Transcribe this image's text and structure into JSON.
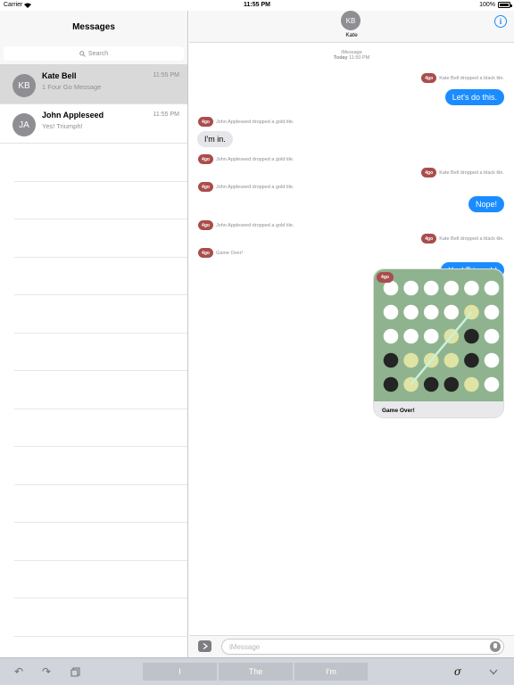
{
  "status_bar": {
    "carrier": "Carrier",
    "time": "11:55 PM",
    "battery": "100%"
  },
  "sidebar": {
    "title": "Messages",
    "search_placeholder": "Search",
    "conversations": [
      {
        "initials": "KB",
        "name": "Kate Bell",
        "time": "11:55 PM",
        "preview": "1 Four Go Message"
      },
      {
        "initials": "JA",
        "name": "John Appleseed",
        "time": "11:55 PM",
        "preview": "Yes! Triumph!"
      }
    ]
  },
  "chat": {
    "contact_initials": "KB",
    "contact_name": "Kate",
    "service": "iMessage",
    "timestamp_day": "Today",
    "timestamp_time": "11:50 PM",
    "badge_label": "4go",
    "events": [
      {
        "kind": "sys",
        "side": "right",
        "text": "Kate Bell dropped a black tile."
      },
      {
        "kind": "bubble",
        "side": "right",
        "text": "Let's do this."
      },
      {
        "kind": "sys",
        "side": "left",
        "text": "John Appleseed dropped a gold tile."
      },
      {
        "kind": "bubble",
        "side": "left",
        "text": "I'm in."
      },
      {
        "kind": "sys",
        "side": "left",
        "text": "John Appleseed dropped a gold tile."
      },
      {
        "kind": "sys",
        "side": "right",
        "text": "Kate Bell dropped a black tile."
      },
      {
        "kind": "sys",
        "side": "left",
        "text": "John Appleseed dropped a gold tile."
      },
      {
        "kind": "bubble",
        "side": "right",
        "text": "Nope!"
      },
      {
        "kind": "sys",
        "side": "left",
        "text": "John Appleseed dropped a gold tile."
      },
      {
        "kind": "sys",
        "side": "right",
        "text": "Kate Bell dropped a black tile."
      },
      {
        "kind": "sys",
        "side": "left",
        "text": "Game Over!"
      },
      {
        "kind": "bubble",
        "side": "right",
        "text": "Yes! Triumph!"
      }
    ],
    "game_card": {
      "caption": "Game Over!",
      "board": [
        [
          "empty",
          "empty",
          "empty",
          "empty",
          "empty",
          "empty"
        ],
        [
          "empty",
          "empty",
          "empty",
          "empty",
          "gold",
          "empty"
        ],
        [
          "empty",
          "empty",
          "empty",
          "gold",
          "black",
          "empty"
        ],
        [
          "black",
          "gold",
          "gold",
          "gold",
          "black",
          "empty"
        ],
        [
          "black",
          "gold",
          "black",
          "black",
          "gold",
          "empty"
        ]
      ],
      "colors": {
        "board": "#8fb38f",
        "empty": "#ffffff",
        "gold": "#dfe3a3",
        "black": "#242424",
        "win_line": "#c9f2dc"
      }
    },
    "input_placeholder": "iMessage"
  },
  "keyboard_bar": {
    "suggestions": [
      "I",
      "The",
      "I'm"
    ],
    "icons": [
      "undo-icon",
      "redo-icon",
      "paste-icon",
      "handwriting-icon",
      "dismiss-keyboard-icon"
    ]
  },
  "colors": {
    "accent": "#1a8cff",
    "incoming_bubble": "#e5e5ea",
    "game_badge": "#a94d4d"
  }
}
